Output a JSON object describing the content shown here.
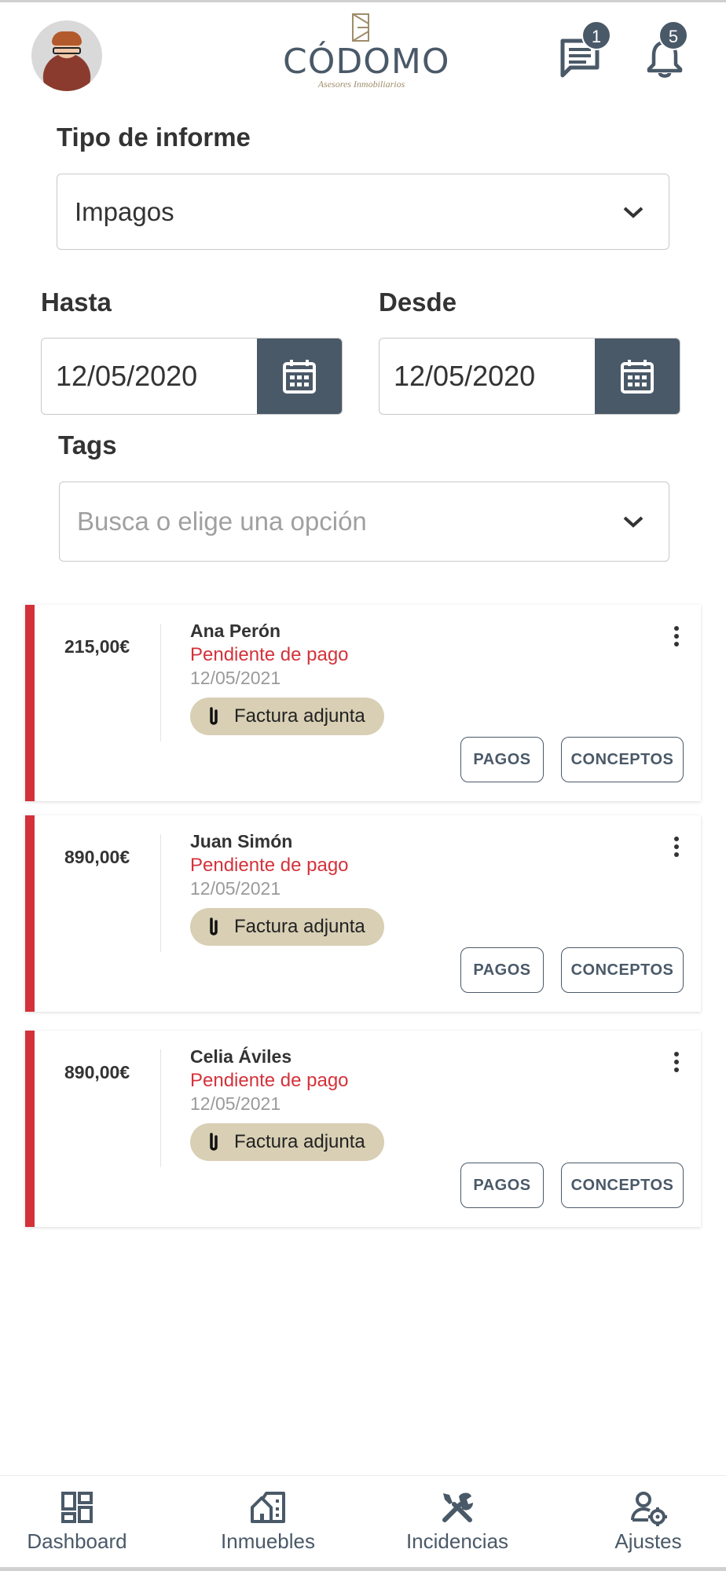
{
  "header": {
    "brand": "CÓDOMO",
    "tagline": "Asesores Inmobiliarios",
    "messages_badge": "1",
    "notifications_badge": "5"
  },
  "form": {
    "report_type_label": "Tipo de informe",
    "report_type_value": "Impagos",
    "hasta_label": "Hasta",
    "hasta_value": "12/05/2020",
    "desde_label": "Desde",
    "desde_value": "12/05/2020",
    "tags_label": "Tags",
    "tags_placeholder": "Busca o elige una opción"
  },
  "cards": [
    {
      "amount": "215,00€",
      "name": "Ana Perón",
      "status": "Pendiente de pago",
      "date": "12/05/2021",
      "chip": "Factura adjunta",
      "pagos_label": "PAGOS",
      "conceptos_label": "CONCEPTOS"
    },
    {
      "amount": "890,00€",
      "name": "Juan Simón",
      "status": "Pendiente de pago",
      "date": "12/05/2021",
      "chip": "Factura adjunta",
      "pagos_label": "PAGOS",
      "conceptos_label": "CONCEPTOS"
    },
    {
      "amount": "890,00€",
      "name": "Celia Áviles",
      "status": "Pendiente de pago",
      "date": "12/05/2021",
      "chip": "Factura adjunta",
      "pagos_label": "PAGOS",
      "conceptos_label": "CONCEPTOS"
    }
  ],
  "nav": [
    {
      "label": "Dashboard",
      "icon": "dashboard-icon"
    },
    {
      "label": "Inmuebles",
      "icon": "buildings-icon"
    },
    {
      "label": "Incidencias",
      "icon": "tools-icon"
    },
    {
      "label": "Ajustes",
      "icon": "user-settings-icon"
    }
  ],
  "colors": {
    "primary": "#4a5968",
    "alert": "#d3323a",
    "chip": "#d8cfb4",
    "brand_gold": "#a08c6a"
  }
}
